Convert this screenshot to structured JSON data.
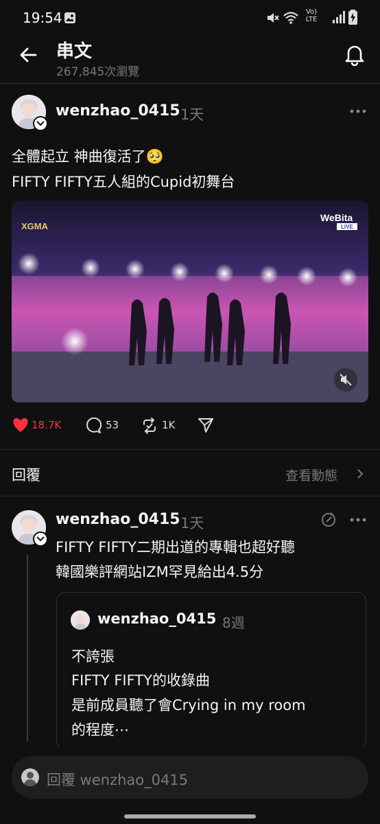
{
  "status_bar": {
    "time": "19:54",
    "signal_label": "Vo) LTE",
    "battery_icon": "battery-charging-icon"
  },
  "header": {
    "title": "串文",
    "views": "267,845次瀏覽"
  },
  "post": {
    "username": "wenzhao_0415",
    "age": "1天",
    "line1": "全體起立 神曲復活了🥺",
    "line2": "FIFTY FIFTY五人組的Cupid初舞台",
    "video_watermark_left": "XGMA",
    "video_watermark_right": "WeBita",
    "video_live_badge": "LIVE",
    "likes": "18.7K",
    "comments": "53",
    "reposts": "1K"
  },
  "replies_section": {
    "title": "回覆",
    "see_activity": "查看動態"
  },
  "reply": {
    "username": "wenzhao_0415",
    "age": "1天",
    "line1": "FIFTY FIFTY二期出道的專輯也超好聽",
    "line2": "韓國樂評網站IZM罕見給出4.5分",
    "quote": {
      "username": "wenzhao_0415",
      "age": "8週",
      "line1": "不誇張",
      "line2": "FIFTY FIFTY的收錄曲",
      "line3": "是前成員聽了會Crying in my room",
      "line4": "的程度⋯"
    }
  },
  "composer": {
    "placeholder": "回覆 wenzhao_0415"
  },
  "colors": {
    "background": "#101010",
    "like": "#ff3040",
    "muted": "#777777"
  }
}
